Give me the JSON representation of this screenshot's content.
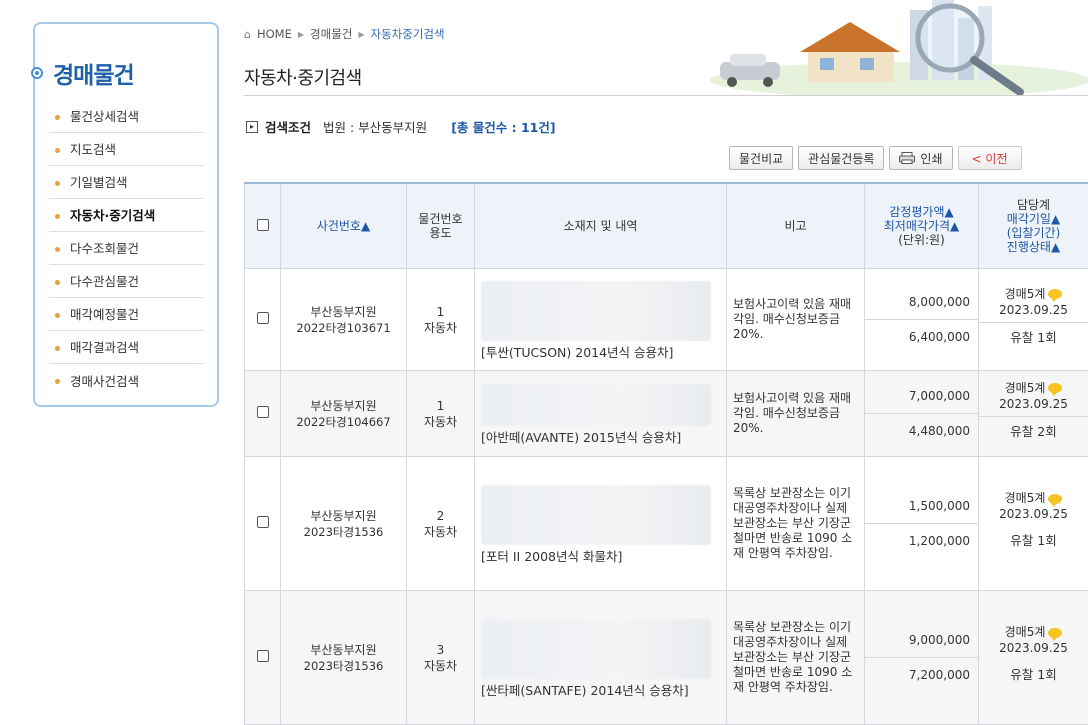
{
  "breadcrumb": {
    "home": "HOME",
    "level1": "경매물건",
    "level2": "자동차중기검색"
  },
  "page_title": "자동차·중기검색",
  "sidebar": {
    "title": "경매물건",
    "items": [
      {
        "label": "물건상세검색",
        "active": false
      },
      {
        "label": "지도검색",
        "active": false
      },
      {
        "label": "기일별검색",
        "active": false
      },
      {
        "label": "자동차·중기검색",
        "active": true
      },
      {
        "label": "다수조회물건",
        "active": false
      },
      {
        "label": "다수관심물건",
        "active": false
      },
      {
        "label": "매각예정물건",
        "active": false
      },
      {
        "label": "매각결과검색",
        "active": false
      },
      {
        "label": "경매사건검색",
        "active": false
      }
    ]
  },
  "search": {
    "label": "검색조건",
    "court": "법원 : 부산동부지원",
    "total": "[총 물건수 : 11건]"
  },
  "buttons": {
    "compare": "물건비교",
    "watch": "관심물건등록",
    "print": "인쇄",
    "prev": "< 이전"
  },
  "table": {
    "headers": {
      "case": "사건번호▲",
      "item_no": "물건번호",
      "usage": "용도",
      "location": "소재지 및 내역",
      "note": "비고",
      "appraisal": "감정평가액▲",
      "minimum": "최저매각가격▲",
      "unit": "(단위:원)",
      "division": "담당계",
      "sale_date": "매각기일▲",
      "bid_period": "(입찰기간)",
      "status": "진행상태▲"
    },
    "rows": [
      {
        "court": "부산동부지원",
        "case_no": "2022타경103671",
        "item_no": "1",
        "usage": "자동차",
        "desc": "[투싼(TUCSON) 2014년식 승용차]",
        "note": "보험사고이력 있음 재매각임. 매수신청보증금 20%.",
        "appraisal": "8,000,000",
        "minimum": "6,400,000",
        "division": "경매5계",
        "date": "2023.09.25",
        "result": "유찰 1회"
      },
      {
        "court": "부산동부지원",
        "case_no": "2022타경104667",
        "item_no": "1",
        "usage": "자동차",
        "desc": "[아반떼(AVANTE) 2015년식 승용차]",
        "note": "보험사고이력 있음 재매각임. 매수신청보증금 20%.",
        "appraisal": "7,000,000",
        "minimum": "4,480,000",
        "division": "경매5계",
        "date": "2023.09.25",
        "result": "유찰 2회"
      },
      {
        "court": "부산동부지원",
        "case_no": "2023타경1536",
        "item_no": "2",
        "usage": "자동차",
        "desc": "[포터 II 2008년식 화물차]",
        "note": "목록상 보관장소는 이기대공영주차장이나 실제 보관장소는 부산 기장군 철마면 반송로 1090 소재 안평역 주차장임.",
        "appraisal": "1,500,000",
        "minimum": "1,200,000",
        "division": "경매5계",
        "date": "2023.09.25",
        "result": "유찰 1회"
      },
      {
        "court": "부산동부지원",
        "case_no": "2023타경1536",
        "item_no": "3",
        "usage": "자동차",
        "desc": "[싼타페(SANTAFE) 2014년식 승용차]",
        "note": "목록상 보관장소는 이기대공영주차장이나 실제 보관장소는 부산 기장군 철마면 반송로 1090 소재 안평역 주차장임.",
        "appraisal": "9,000,000",
        "minimum": "7,200,000",
        "division": "경매5계",
        "date": "2023.09.25",
        "result": "유찰 1회"
      }
    ]
  }
}
